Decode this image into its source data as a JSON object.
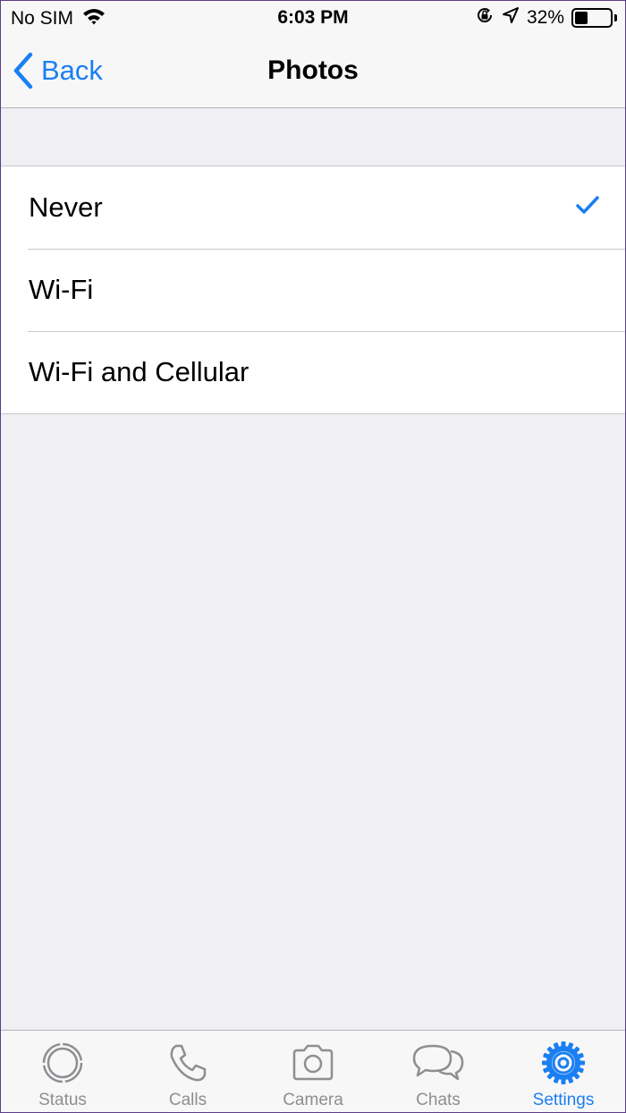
{
  "status_bar": {
    "carrier": "No SIM",
    "time": "6:03 PM",
    "battery_percent": "32%",
    "battery_level": 0.32
  },
  "nav": {
    "back_label": "Back",
    "title": "Photos"
  },
  "options": [
    {
      "label": "Never",
      "selected": true
    },
    {
      "label": "Wi-Fi",
      "selected": false
    },
    {
      "label": "Wi-Fi and Cellular",
      "selected": false
    }
  ],
  "tabs": [
    {
      "label": "Status",
      "icon": "status-icon",
      "active": false
    },
    {
      "label": "Calls",
      "icon": "phone-icon",
      "active": false
    },
    {
      "label": "Camera",
      "icon": "camera-icon",
      "active": false
    },
    {
      "label": "Chats",
      "icon": "chat-bubbles-icon",
      "active": false
    },
    {
      "label": "Settings",
      "icon": "gear-icon",
      "active": true
    }
  ],
  "colors": {
    "accent": "#1a7ff2",
    "inactive": "#8e8e93",
    "background": "#efeff4"
  }
}
